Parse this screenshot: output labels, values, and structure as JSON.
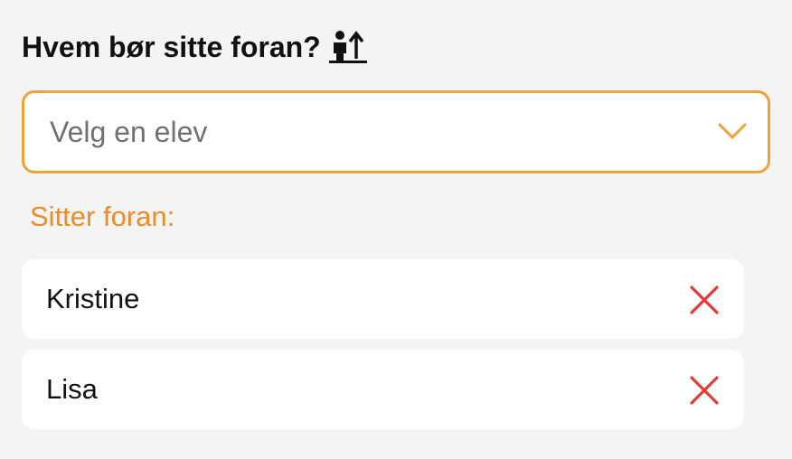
{
  "heading": {
    "text": "Hvem bør sitte foran?",
    "icon": "person-front-icon"
  },
  "select": {
    "placeholder": "Velg en elev",
    "icon": "chevron-down-icon",
    "accent_color": "#f0a23a"
  },
  "section_label": "Sitter foran:",
  "students": [
    {
      "name": "Kristine",
      "remove_icon": "close-icon"
    },
    {
      "name": "Lisa",
      "remove_icon": "close-icon"
    }
  ],
  "colors": {
    "accent": "#f08a24",
    "remove": "#e53935",
    "background": "#f4f4f4"
  }
}
